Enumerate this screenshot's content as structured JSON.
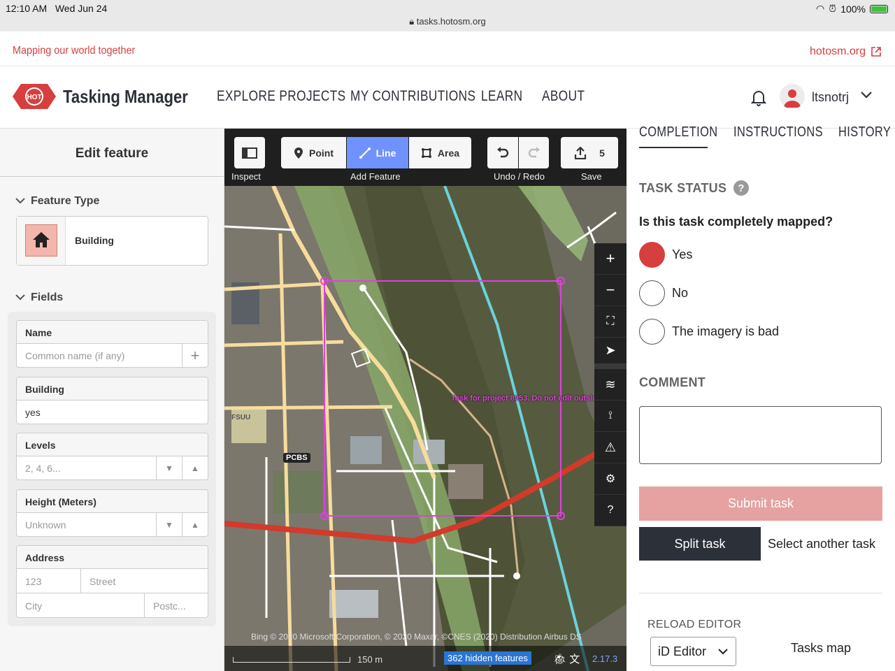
{
  "status_bar": {
    "time": "12:10 AM",
    "date": "Wed Jun 24",
    "url": "tasks.hotosm.org",
    "battery": "100%"
  },
  "tagline": {
    "left": "Mapping our world together",
    "right": "hotosm.org"
  },
  "nav": {
    "logo_badge": "HOT",
    "logo_text": "Tasking Manager",
    "menu": [
      "EXPLORE PROJECTS",
      "MY CONTRIBUTIONS",
      "LEARN",
      "ABOUT"
    ],
    "username": "ltsnotrj"
  },
  "left_panel": {
    "title": "Edit feature",
    "feature_type_heading": "Feature Type",
    "preset_label": "Building",
    "fields_heading": "Fields",
    "fields": {
      "name": {
        "label": "Name",
        "placeholder": "Common name (if any)"
      },
      "building": {
        "label": "Building",
        "value": "yes"
      },
      "levels": {
        "label": "Levels",
        "placeholder": "2, 4, 6..."
      },
      "height": {
        "label": "Height (Meters)",
        "placeholder": "Unknown"
      },
      "address": {
        "label": "Address",
        "housenumber": "123",
        "street": "Street",
        "city": "City",
        "postcode": "Postc..."
      }
    }
  },
  "map": {
    "toolbar": {
      "point": "Point",
      "line": "Line",
      "area": "Area",
      "save_count": "5",
      "captions": {
        "inspect": "Inspect",
        "add_feature": "Add Feature",
        "undo_redo": "Undo / Redo",
        "save": "Save"
      }
    },
    "task_label": "Task for project 8953. Do not edit outside th",
    "labels": {
      "pcbs": "PCBS",
      "fsuu": "FSUU"
    },
    "attribution": "Bing  © 2020 Microsoft Corporation, © 2020 Maxar, ©CNES (2020) Distribution Airbus DS",
    "scale": "150 m",
    "hidden_features": "362 hidden features",
    "version": "2.17.3",
    "colors": {
      "task_boundary": "#e040e0",
      "primary_road": "#d23a2b",
      "river_line": "#6ad3dc",
      "residential_road": "#ffffff",
      "secondary_road": "#f7dc9c"
    }
  },
  "right_panel": {
    "tabs": [
      "COMPLETION",
      "INSTRUCTIONS",
      "HISTORY"
    ],
    "task_status_heading": "TASK STATUS",
    "question": "Is this task completely mapped?",
    "options": [
      "Yes",
      "No",
      "The imagery is bad"
    ],
    "selected_option": "Yes",
    "comment_heading": "COMMENT",
    "submit_label": "Submit task",
    "split_label": "Split task",
    "select_another_label": "Select another task",
    "reload_editor_heading": "RELOAD EDITOR",
    "editor_value": "iD Editor",
    "tasks_map_label": "Tasks map",
    "accent": "#d73f3f"
  }
}
